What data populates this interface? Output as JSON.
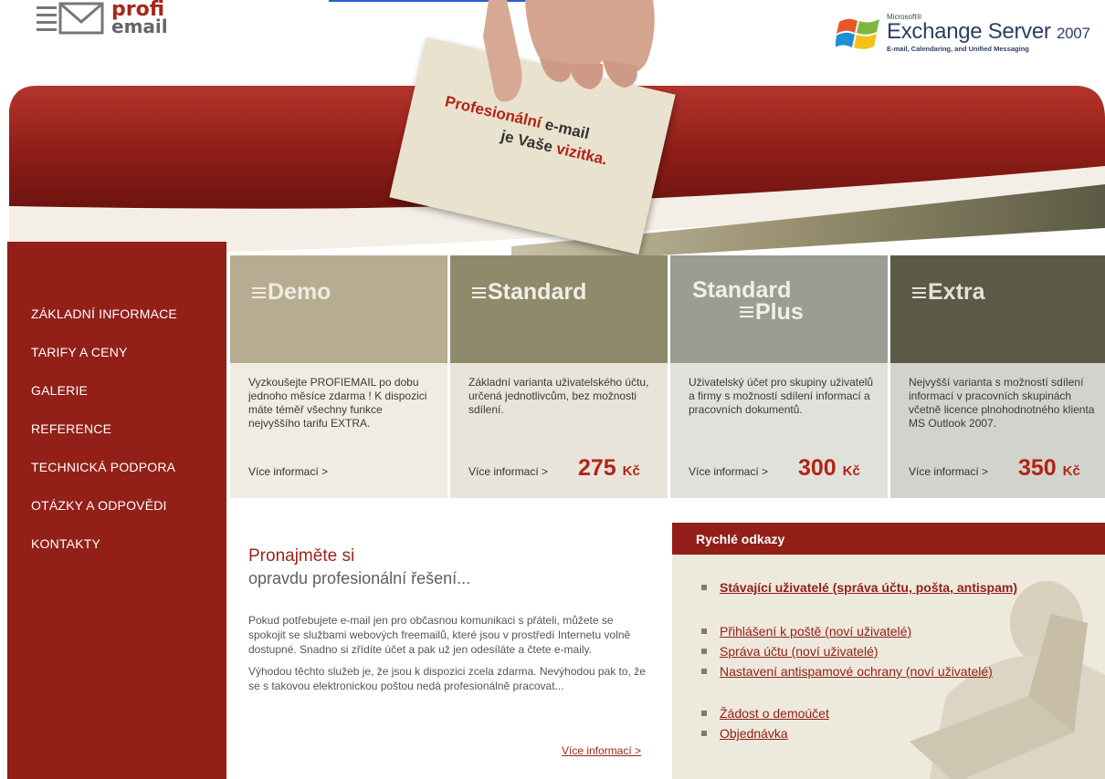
{
  "header": {
    "logo_word1": "profi",
    "logo_word2": "email",
    "ms_small": "Microsoft®",
    "ms_title": "Exchange Server",
    "ms_year": "2007",
    "ms_subtitle": "E-mail, Calendaring, and Unified Messaging"
  },
  "banner": {
    "line1_a": "Profesionální",
    "line1_b": " e-mail",
    "line2_a": "je Vaše ",
    "line2_b": "vizitka."
  },
  "nav": {
    "items": [
      "ZÁKLADNÍ INFORMACE",
      "TARIFY A CENY",
      "GALERIE",
      "REFERENCE",
      "TECHNICKÁ PODPORA",
      "OTÁZKY A ODPOVĚDI",
      "KONTAKTY"
    ]
  },
  "tariffs": {
    "demo": {
      "name": "Demo",
      "desc": "Vyzkoušejte PROFIEMAIL po dobu jednoho měsíce zdarma ! K dispozici máte téměř všechny funkce nejvyššího tarifu EXTRA.",
      "more": "Více informací >"
    },
    "standard": {
      "name": "Standard",
      "desc": "Základní varianta uživatelského účtu, určená jednotlivcům, bez možnosti sdílení.",
      "more": "Více informací >",
      "price": "275",
      "currency": "Kč"
    },
    "plus": {
      "name1": "Standard",
      "name2": "Plus",
      "desc": "Uživatelský účet pro skupiny uživatelů a firmy s možností sdílení informací a pracovních dokumentů.",
      "more": "Více informací >",
      "price": "300",
      "currency": "Kč"
    },
    "extra": {
      "name": "Extra",
      "desc": "Nejvyšší varianta s možností sdílení informací v pracovních skupinách včetně licence plnohodnotného klienta MS Outlook 2007.",
      "more": "Více informací >",
      "price": "350",
      "currency": "Kč"
    }
  },
  "content": {
    "headline1": "Pronajměte si",
    "headline2": "opravdu profesionální řešení...",
    "para1": "Pokud potřebujete e-mail jen pro občasnou komunikaci s přáteli, můžete se spokojit se službami webových freemailů, které jsou v prostředí Internetu volně dostupné. Snadno si zřídíte účet a pak už jen odesíláte a čtete e-maily.",
    "para2": "Výhodou těchto služeb je, že jsou k dispozici zcela zdarma. Nevýhodou pak to, že se s takovou elektronickou poštou nedá profesionálně pracovat...",
    "more": "Více informací >"
  },
  "quick": {
    "title": "Rychlé odkazy",
    "link_existing": "Stávající uživatelé (správa účtu, pošta, antispam)",
    "link_login": "Přihlášení k poště (noví uživatelé)",
    "link_account": "Správa účtu (noví uživatelé)",
    "link_antispam": "Nastavení antispamové ochrany (noví uživatelé)",
    "link_demo": "Žádost o demoúčet",
    "link_order": "Objednávka"
  },
  "colors": {
    "brand_red": "#922018",
    "accent_red": "#b32317",
    "demo": "#b7ac92",
    "standard": "#8f8a6b",
    "plus": "#9b9d92",
    "extra": "#5a5a46"
  }
}
